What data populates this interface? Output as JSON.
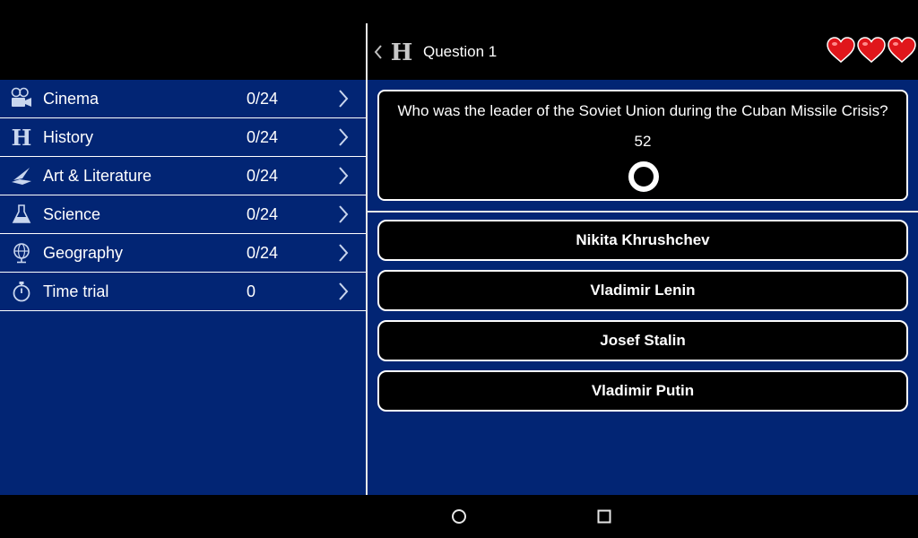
{
  "sidebar": {
    "categories": [
      {
        "label": "Cinema",
        "score": "0/24",
        "icon": "film-camera-icon"
      },
      {
        "label": "History",
        "score": "0/24",
        "icon": "history-h-icon"
      },
      {
        "label": "Art & Literature",
        "score": "0/24",
        "icon": "quill-book-icon"
      },
      {
        "label": "Science",
        "score": "0/24",
        "icon": "flask-icon"
      },
      {
        "label": "Geography",
        "score": "0/24",
        "icon": "globe-icon"
      },
      {
        "label": "Time trial",
        "score": "0",
        "icon": "stopwatch-icon"
      }
    ]
  },
  "header": {
    "title": "Question 1",
    "lives": 3
  },
  "question": {
    "text": "Who was the leader of the Soviet Union during the Cuban Missile Crisis?",
    "timer": "52"
  },
  "answers": [
    {
      "label": "Nikita Khrushchev"
    },
    {
      "label": "Vladimir Lenin"
    },
    {
      "label": "Josef Stalin"
    },
    {
      "label": "Vladimir Putin"
    }
  ],
  "colors": {
    "panel_blue": "#022574",
    "heart_red": "#e0161b",
    "border": "#ffffff"
  }
}
